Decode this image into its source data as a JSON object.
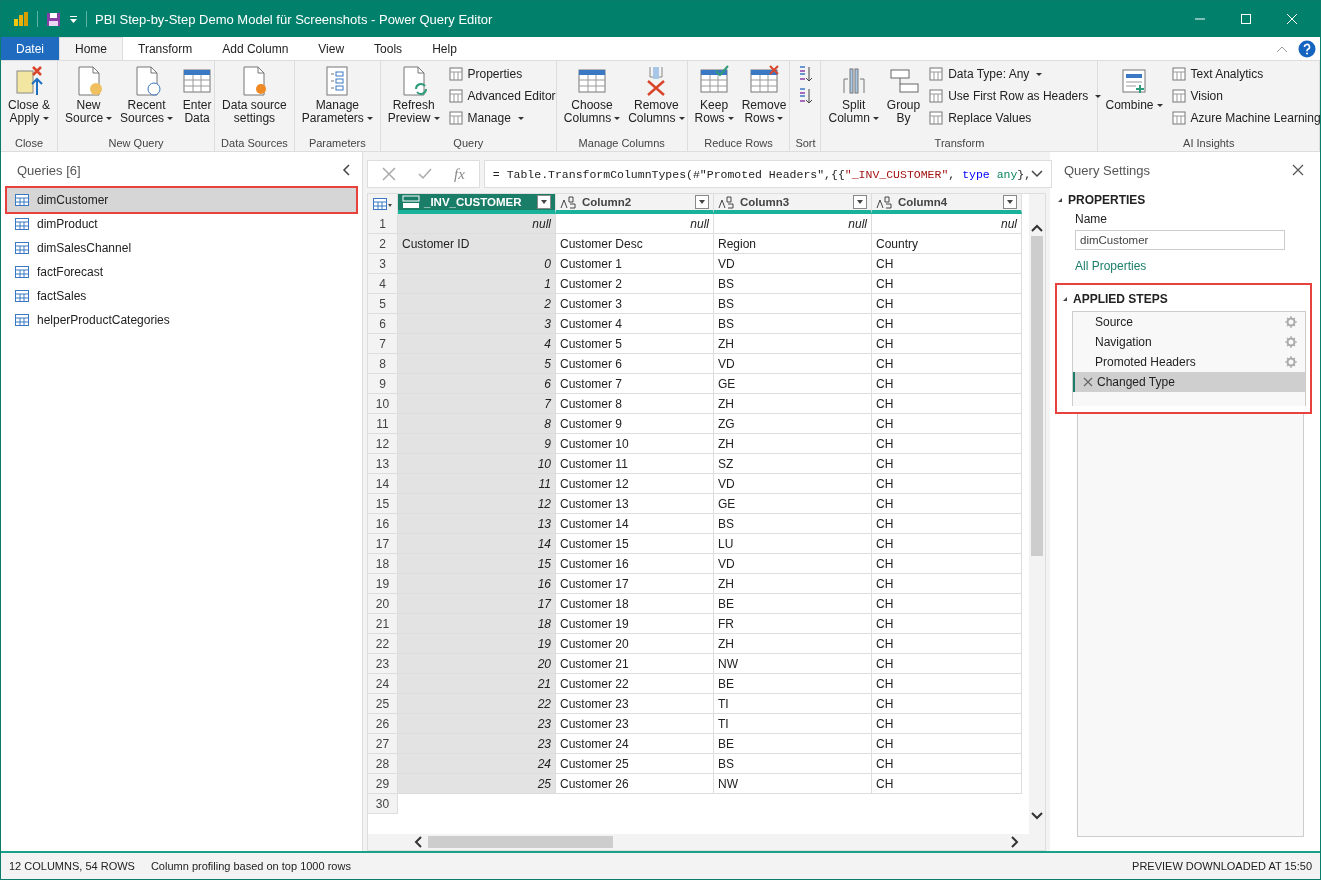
{
  "window": {
    "title": "PBI Step-by-Step Demo Model für Screenshots - Power Query Editor"
  },
  "menu_tabs": [
    {
      "label": "Datei",
      "kind": "file",
      "selected": false
    },
    {
      "label": "Home",
      "kind": "tab",
      "selected": true
    },
    {
      "label": "Transform",
      "kind": "tab",
      "selected": false
    },
    {
      "label": "Add Column",
      "kind": "tab",
      "selected": false
    },
    {
      "label": "View",
      "kind": "tab",
      "selected": false
    },
    {
      "label": "Tools",
      "kind": "tab",
      "selected": false
    },
    {
      "label": "Help",
      "kind": "tab",
      "selected": false
    }
  ],
  "ribbon": [
    {
      "label": "Close",
      "items": [
        {
          "kind": "large",
          "lines": [
            "Close &",
            "Apply"
          ],
          "dropdown": true
        }
      ]
    },
    {
      "label": "New Query",
      "items": [
        {
          "kind": "large",
          "lines": [
            "New",
            "Source"
          ],
          "dropdown": true
        },
        {
          "kind": "large",
          "lines": [
            "Recent",
            "Sources"
          ],
          "dropdown": true
        },
        {
          "kind": "large",
          "lines": [
            "Enter",
            "Data"
          ],
          "dropdown": false
        }
      ]
    },
    {
      "label": "Data Sources",
      "items": [
        {
          "kind": "large",
          "lines": [
            "Data source",
            "settings"
          ],
          "dropdown": false
        }
      ]
    },
    {
      "label": "Parameters",
      "items": [
        {
          "kind": "large",
          "lines": [
            "Manage",
            "Parameters"
          ],
          "dropdown": true
        }
      ]
    },
    {
      "label": "Query",
      "items": [
        {
          "kind": "large",
          "lines": [
            "Refresh",
            "Preview"
          ],
          "dropdown": true
        },
        {
          "kind": "small",
          "lines": [
            "Properties"
          ],
          "dropdown": false
        },
        {
          "kind": "small",
          "lines": [
            "Advanced Editor"
          ],
          "dropdown": false
        },
        {
          "kind": "small",
          "lines": [
            "Manage"
          ],
          "dropdown": true
        }
      ]
    },
    {
      "label": "Manage Columns",
      "items": [
        {
          "kind": "large",
          "lines": [
            "Choose",
            "Columns"
          ],
          "dropdown": true
        },
        {
          "kind": "large",
          "lines": [
            "Remove",
            "Columns"
          ],
          "dropdown": true
        }
      ]
    },
    {
      "label": "Reduce Rows",
      "items": [
        {
          "kind": "large",
          "lines": [
            "Keep",
            "Rows"
          ],
          "dropdown": true
        },
        {
          "kind": "large",
          "lines": [
            "Remove",
            "Rows"
          ],
          "dropdown": true
        }
      ]
    },
    {
      "label": "Sort",
      "items": [
        {
          "kind": "icon"
        },
        {
          "kind": "icon"
        }
      ]
    },
    {
      "label": "Transform",
      "items": [
        {
          "kind": "large",
          "lines": [
            "Split",
            "Column"
          ],
          "dropdown": true
        },
        {
          "kind": "large",
          "lines": [
            "Group",
            "By"
          ],
          "dropdown": false
        },
        {
          "kind": "small",
          "lines": [
            "Data Type: Any"
          ],
          "dropdown": true
        },
        {
          "kind": "small",
          "lines": [
            "Use First Row as Headers"
          ],
          "dropdown": true
        },
        {
          "kind": "small",
          "lines": [
            "Replace Values"
          ],
          "dropdown": false
        }
      ]
    },
    {
      "label": "AI Insights",
      "items": [
        {
          "kind": "large",
          "lines": [
            "Combine"
          ],
          "dropdown": true
        },
        {
          "kind": "small",
          "lines": [
            "Text Analytics"
          ],
          "dropdown": false
        },
        {
          "kind": "small",
          "lines": [
            "Vision"
          ],
          "dropdown": false
        },
        {
          "kind": "small",
          "lines": [
            "Azure Machine Learning"
          ],
          "dropdown": false
        }
      ]
    }
  ],
  "queries": {
    "title": "Queries [6]",
    "items": [
      {
        "name": "dimCustomer",
        "selected": true
      },
      {
        "name": "dimProduct",
        "selected": false
      },
      {
        "name": "dimSalesChannel",
        "selected": false
      },
      {
        "name": "factForecast",
        "selected": false
      },
      {
        "name": "factSales",
        "selected": false
      },
      {
        "name": "helperProductCategories",
        "selected": false
      }
    ]
  },
  "formula_bar": {
    "fx": "fx",
    "segments": [
      {
        "kind": "code",
        "text": "= Table.TransformColumnTypes(#\"Promoted Headers\",{{"
      },
      {
        "kind": "string",
        "text": "\"_INV_CUSTOMER\""
      },
      {
        "kind": "code",
        "text": ", "
      },
      {
        "kind": "keyword",
        "text": "type"
      },
      {
        "kind": "type",
        "text": "any"
      },
      {
        "kind": "code",
        "text": "},"
      }
    ]
  },
  "table": {
    "columns": [
      {
        "name": "_INV_CUSTOMER",
        "kind": "any",
        "selected": true
      },
      {
        "name": "Column2",
        "kind": "text",
        "selected": false
      },
      {
        "name": "Column3",
        "kind": "text",
        "selected": false
      },
      {
        "name": "Column4",
        "kind": "text",
        "selected": false
      }
    ],
    "rows": [
      {
        "number": "1",
        "cells": [
          "null",
          "null",
          "null",
          "nul"
        ]
      },
      {
        "number": "2",
        "cells": [
          "Customer ID",
          "Customer Desc",
          "Region",
          "Country"
        ]
      },
      {
        "number": "3",
        "cells": [
          "0",
          "Customer 1",
          "VD",
          "CH"
        ]
      },
      {
        "number": "4",
        "cells": [
          "1",
          "Customer 2",
          "BS",
          "CH"
        ]
      },
      {
        "number": "5",
        "cells": [
          "2",
          "Customer 3",
          "BS",
          "CH"
        ]
      },
      {
        "number": "6",
        "cells": [
          "3",
          "Customer 4",
          "BS",
          "CH"
        ]
      },
      {
        "number": "7",
        "cells": [
          "4",
          "Customer 5",
          "ZH",
          "CH"
        ]
      },
      {
        "number": "8",
        "cells": [
          "5",
          "Customer 6",
          "VD",
          "CH"
        ]
      },
      {
        "number": "9",
        "cells": [
          "6",
          "Customer 7",
          "GE",
          "CH"
        ]
      },
      {
        "number": "10",
        "cells": [
          "7",
          "Customer 8",
          "ZH",
          "CH"
        ]
      },
      {
        "number": "11",
        "cells": [
          "8",
          "Customer 9",
          "ZG",
          "CH"
        ]
      },
      {
        "number": "12",
        "cells": [
          "9",
          "Customer 10",
          "ZH",
          "CH"
        ]
      },
      {
        "number": "13",
        "cells": [
          "10",
          "Customer 11",
          "SZ",
          "CH"
        ]
      },
      {
        "number": "14",
        "cells": [
          "11",
          "Customer 12",
          "VD",
          "CH"
        ]
      },
      {
        "number": "15",
        "cells": [
          "12",
          "Customer 13",
          "GE",
          "CH"
        ]
      },
      {
        "number": "16",
        "cells": [
          "13",
          "Customer 14",
          "BS",
          "CH"
        ]
      },
      {
        "number": "17",
        "cells": [
          "14",
          "Customer 15",
          "LU",
          "CH"
        ]
      },
      {
        "number": "18",
        "cells": [
          "15",
          "Customer 16",
          "VD",
          "CH"
        ]
      },
      {
        "number": "19",
        "cells": [
          "16",
          "Customer 17",
          "ZH",
          "CH"
        ]
      },
      {
        "number": "20",
        "cells": [
          "17",
          "Customer 18",
          "BE",
          "CH"
        ]
      },
      {
        "number": "21",
        "cells": [
          "18",
          "Customer 19",
          "FR",
          "CH"
        ]
      },
      {
        "number": "22",
        "cells": [
          "19",
          "Customer 20",
          "ZH",
          "CH"
        ]
      },
      {
        "number": "23",
        "cells": [
          "20",
          "Customer 21",
          "NW",
          "CH"
        ]
      },
      {
        "number": "24",
        "cells": [
          "21",
          "Customer 22",
          "BE",
          "CH"
        ]
      },
      {
        "number": "25",
        "cells": [
          "22",
          "Customer 23",
          "TI",
          "CH"
        ]
      },
      {
        "number": "26",
        "cells": [
          "23",
          "Customer 23",
          "TI",
          "CH"
        ]
      },
      {
        "number": "27",
        "cells": [
          "23",
          "Customer 24",
          "BE",
          "CH"
        ]
      },
      {
        "number": "28",
        "cells": [
          "24",
          "Customer 25",
          "BS",
          "CH"
        ]
      },
      {
        "number": "29",
        "cells": [
          "25",
          "Customer 26",
          "NW",
          "CH"
        ]
      }
    ],
    "last_row_number": "30"
  },
  "query_settings": {
    "title": "Query Settings",
    "properties_heading": "PROPERTIES",
    "name_label": "Name",
    "name_value": "dimCustomer",
    "all_properties": "All Properties",
    "steps_heading": "APPLIED STEPS",
    "steps": [
      {
        "name": "Source",
        "gear": true,
        "selected": false
      },
      {
        "name": "Navigation",
        "gear": true,
        "selected": false
      },
      {
        "name": "Promoted Headers",
        "gear": true,
        "selected": false
      },
      {
        "name": "Changed Type",
        "gear": false,
        "selected": true
      }
    ]
  },
  "status_bar": {
    "left": "12 COLUMNS, 54 ROWS",
    "profiling": "Column profiling based on top 1000 rows",
    "right": "PREVIEW DOWNLOADED AT 15:50"
  }
}
